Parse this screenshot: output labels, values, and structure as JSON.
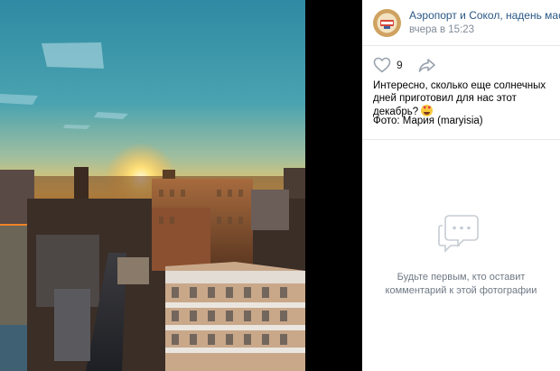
{
  "post": {
    "author": "Аэропорт и Сокол, надень маску",
    "date": "вчера в 15:23",
    "likes": "9",
    "text": "Интересно, сколько еще солнечных дней приготовил для нас этот декабрь?",
    "photo_credit": "Фото: Мария (maryisia)"
  },
  "comments": {
    "empty_line1": "Будьте первым, кто оставит",
    "empty_line2": "комментарий к этой фотографии"
  },
  "icons": {
    "like": "heart-icon",
    "share": "share-arrow-icon",
    "comments": "comments-icon",
    "emoji": "heart-eyes-emoji"
  },
  "colors": {
    "link": "#2a5885",
    "secondary_text": "#818c99",
    "icon_gray": "#99a2ad"
  }
}
